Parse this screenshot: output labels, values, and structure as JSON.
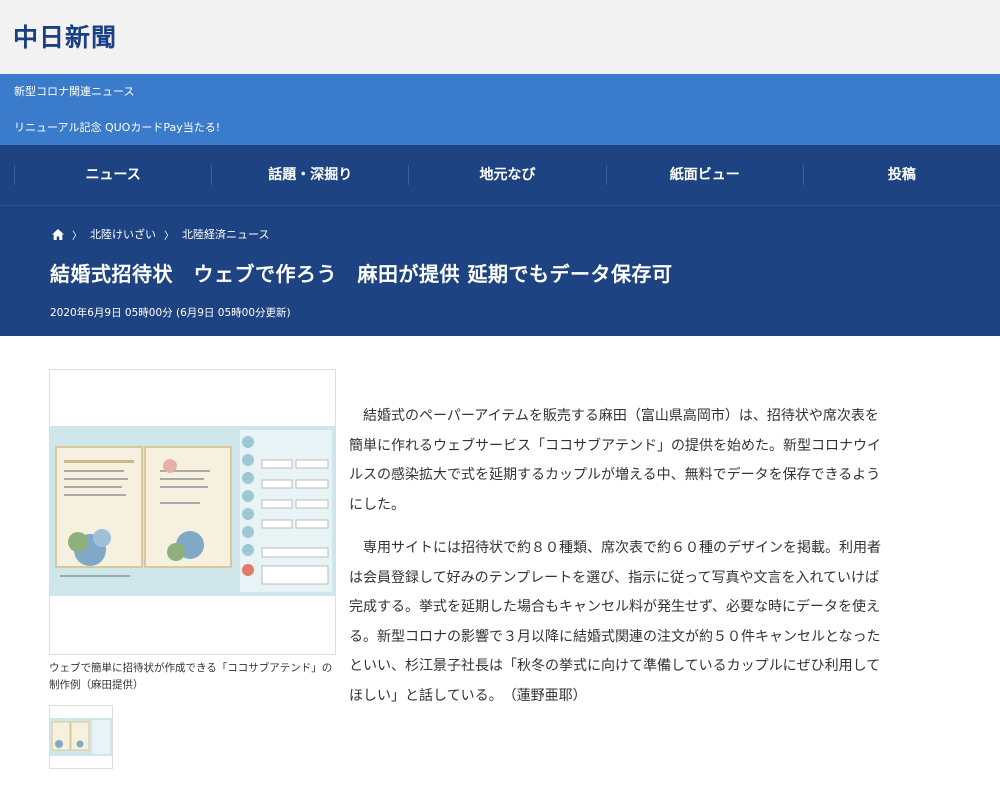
{
  "site": {
    "logo": "中日新聞"
  },
  "promo_links": [
    "新型コロナ関連ニュース",
    "リニューアル記念 QUOカードPay当たる!"
  ],
  "nav": [
    "ニュース",
    "話題・深掘り",
    "地元なび",
    "紙面ビュー",
    "投稿"
  ],
  "breadcrumb": {
    "items": [
      "北陸けいざい",
      "北陸経済ニュース"
    ]
  },
  "article": {
    "title": "結婚式招待状　ウェブで作ろう　麻田が提供 延期でもデータ保存可",
    "date": "2020年6月9日 05時00分 (6月9日 05時00分更新)",
    "paragraphs": [
      "結婚式のペーパーアイテムを販売する麻田（富山県高岡市）は、招待状や席次表を簡単に作れるウェブサービス「ココサブアテンド」の提供を始めた。新型コロナウイルスの感染拡大で式を延期するカップルが増える中、無料でデータを保存できるようにした。",
      "専用サイトには招待状で約８０種類、席次表で約６０種のデザインを掲載。利用者は会員登録して好みのテンプレートを選び、指示に従って写真や文言を入れていけば完成する。挙式を延期した場合もキャンセル料が発生せず、必要な時にデータを使える。新型コロナの影響で３月以降に結婚式関連の注文が約５０件キャンセルとなったといい、杉江景子社長は「秋冬の挙式に向けて準備しているカップルにぜひ利用してほしい」と話している。　（蓮野亜耶）"
    ],
    "image_caption": "ウェブで簡単に招待状が作成できる「ココサブアテンド」の制作例（麻田提供）"
  },
  "colors": {
    "topbar_bg": "#f2f2f2",
    "promo_bg": "#3a7bcb",
    "nav_bg": "#1e4383",
    "logo": "#1b3f86"
  },
  "icons": {
    "home": "home-icon",
    "separator": "chevron-right-icon"
  }
}
